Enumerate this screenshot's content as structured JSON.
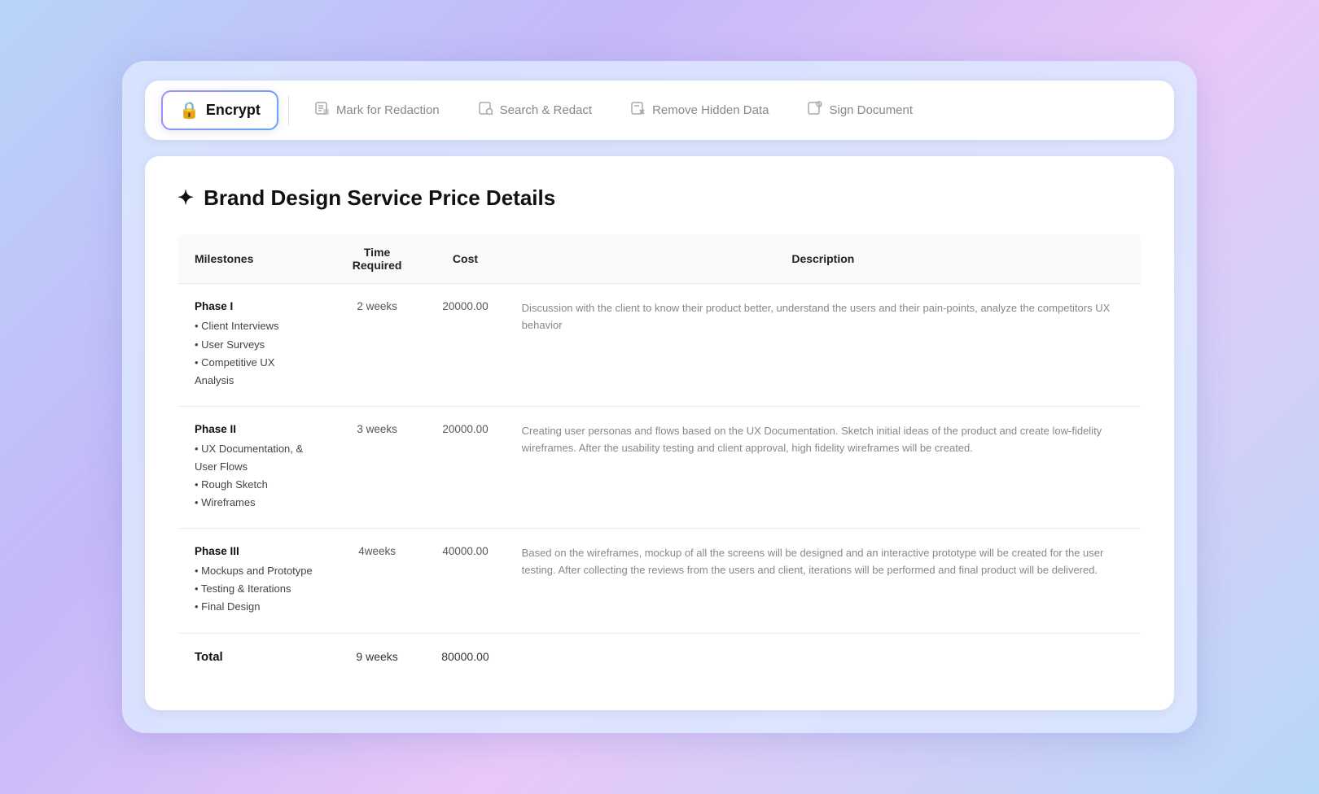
{
  "toolbar": {
    "items": [
      {
        "id": "encrypt",
        "label": "Encrypt",
        "icon": "🔒",
        "active": true
      },
      {
        "id": "mark-for-redaction",
        "label": "Mark for Redaction",
        "icon": "📄",
        "active": false
      },
      {
        "id": "search-redact",
        "label": "Search & Redact",
        "icon": "🔍",
        "active": false
      },
      {
        "id": "remove-hidden-data",
        "label": "Remove Hidden Data",
        "icon": "📋",
        "active": false
      },
      {
        "id": "sign-document",
        "label": "Sign Document",
        "icon": "✍️",
        "active": false
      }
    ]
  },
  "document": {
    "title": "Brand Design Service Price Details",
    "table": {
      "headers": [
        "Milestones",
        "Time Required",
        "Cost",
        "Description"
      ],
      "rows": [
        {
          "phase": "Phase I",
          "items": [
            "• Client Interviews",
            "• User Surveys",
            "• Competitive UX Analysis"
          ],
          "time": "2 weeks",
          "cost": "20000.00",
          "description": "Discussion with the client to know their product better, understand the users and their pain-points, analyze the competitors UX behavior"
        },
        {
          "phase": "Phase II",
          "items": [
            "• UX Documentation, & User Flows",
            "• Rough Sketch",
            "• Wireframes"
          ],
          "time": "3 weeks",
          "cost": "20000.00",
          "description": "Creating user personas and flows based on the UX Documentation. Sketch initial ideas of the product and create low-fidelity wireframes. After the usability testing and client approval, high fidelity wireframes will be created."
        },
        {
          "phase": "Phase III",
          "items": [
            "• Mockups and Prototype",
            "• Testing & Iterations",
            "• Final Design"
          ],
          "time": "4weeks",
          "cost": "40000.00",
          "description": "Based on the wireframes, mockup of all the screens will be designed and an interactive prototype will be created for the user testing. After collecting the reviews from the users and client, iterations will be performed and final product will be delivered."
        }
      ],
      "total": {
        "label": "Total",
        "time": "9 weeks",
        "cost": "80000.00"
      }
    }
  }
}
